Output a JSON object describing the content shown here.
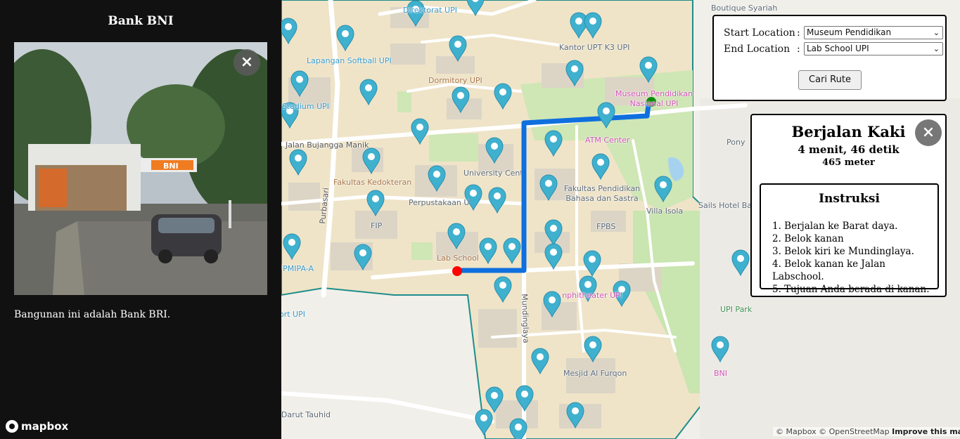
{
  "sidebar": {
    "title": "Bank BNI",
    "description": "Bangunan ini adalah Bank BRI.",
    "photo_sign": "BNI",
    "close_icon": "×",
    "brand": "mapbox"
  },
  "route_form": {
    "start_label": "Start Location",
    "start_value": "Museum Pendidikan",
    "end_label": "End Location",
    "end_value": "Lab School UPI",
    "colon": ":",
    "submit_label": "Cari Rute"
  },
  "directions": {
    "mode": "Berjalan Kaki",
    "duration": "4 menit, 46 detik",
    "distance": "465 meter",
    "close_icon": "×",
    "instructions_title": "Instruksi",
    "instructions": [
      "1. Berjalan ke Barat daya.",
      "2. Belok kanan",
      "3. Belok kiri ke Mundinglaya.",
      "4. Belok kanan ke Jalan Labschool.",
      "5. Tujuan Anda berada di kanan."
    ]
  },
  "map": {
    "labels": {
      "direktorat": "Direktorat UPI",
      "lapangan_softball": "Lapangan Softball UPI",
      "dormitory": "Dormitory UPI",
      "kantor_upt": "Kantor UPT K3 UPI",
      "museum": "Museum Pendidikan Nasional UPI",
      "stadium": "Stadium UPI",
      "jalan_bujangga": "Jalan Bujangga Manik",
      "atm_center": "ATM Center",
      "university_center": "University Center",
      "fakultas_kedokteran": "Fakultas Kedokteran",
      "perpustakaan": "Perpustakaan UPI",
      "fpbs_full": "Fakultas Pendidikan Bahasa dan Sastra",
      "villa_isola": "Villa Isola",
      "purbasari": "Purbasari",
      "fip": "FIP",
      "fpbs": "FPBS",
      "fpmipa": "FPMIPA-A",
      "lab_school": "Lab School",
      "sport_upi": "Sport UPI",
      "amphitheater": "Amphitheater UPI",
      "mundinglaya": "Mundinglaya",
      "upi_park": "UPI Park",
      "mesjid": "Mesjid Al Furqon",
      "bni": "BNI",
      "boutique": "Boutique Syariah",
      "pony": "Pony",
      "sails_hotel": "Sails Hotel Ba",
      "darut_tauhid": "Darut Tauhid"
    },
    "route_color": "#0f6fde",
    "start_marker_color": "#0a8a0a",
    "end_marker_color": "#ff0000",
    "pin_color": "#3fb1ce",
    "attribution": "© Mapbox © OpenStreetMap",
    "improve_label": "Improve this map"
  }
}
